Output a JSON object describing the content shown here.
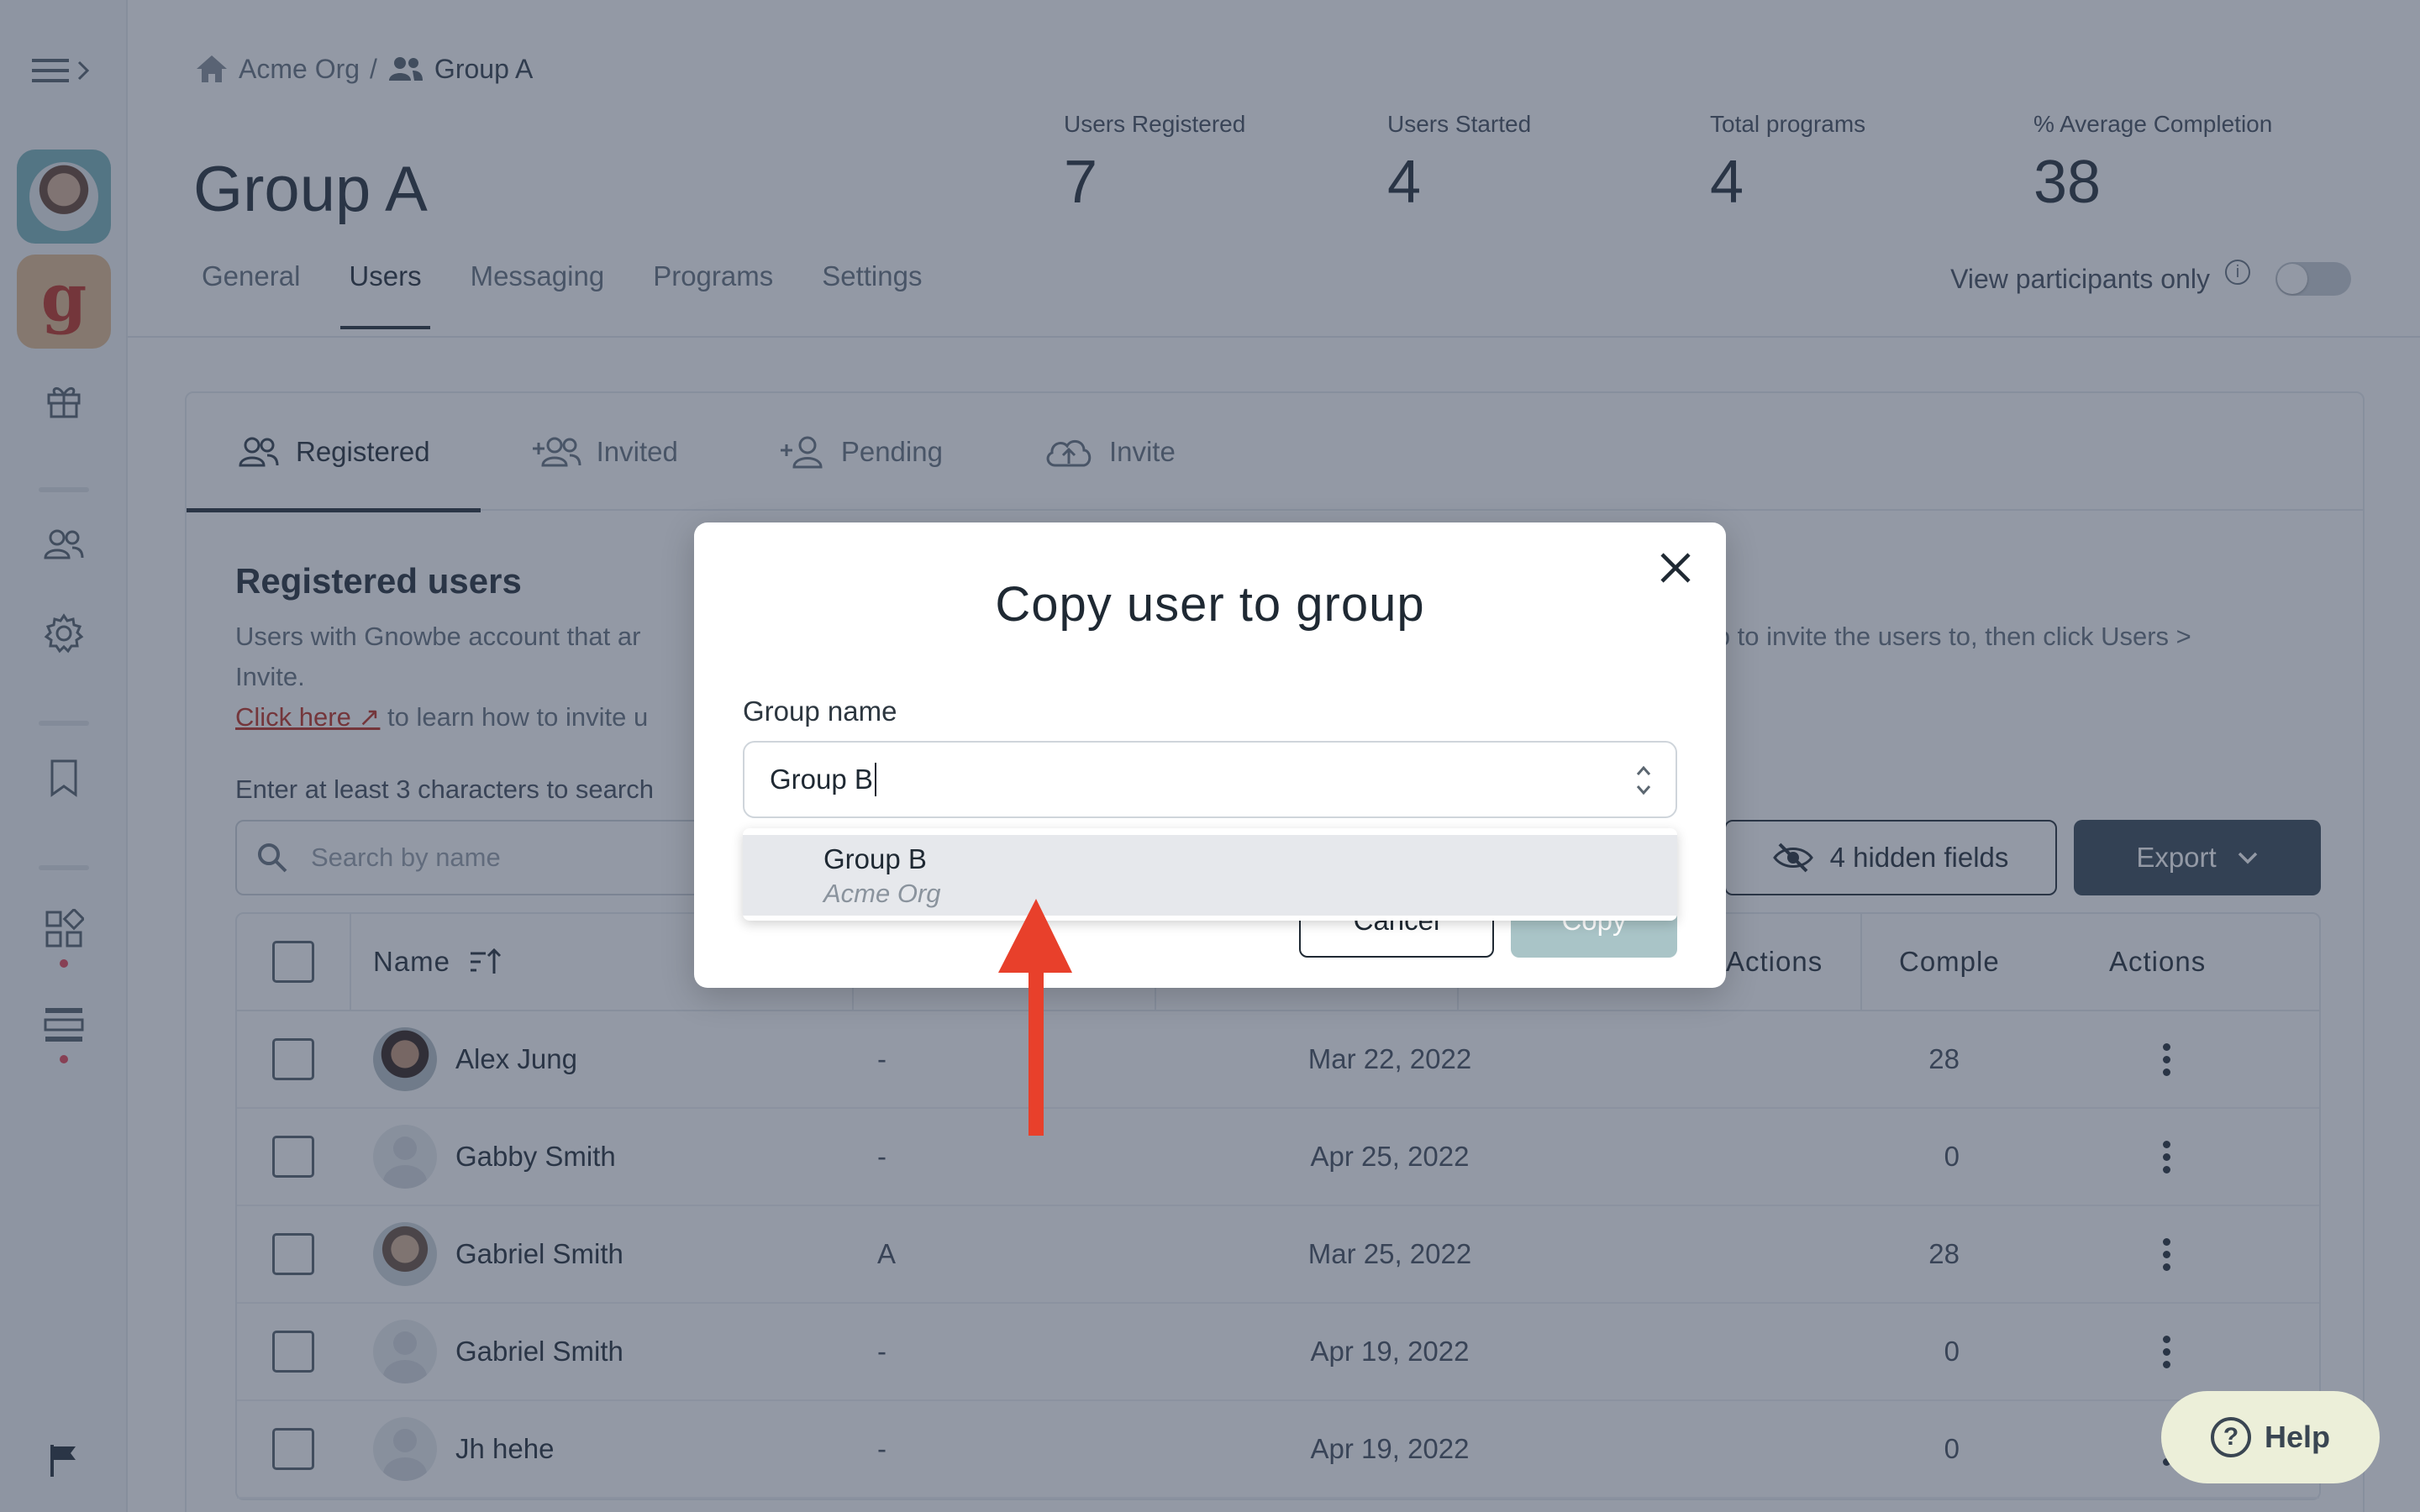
{
  "breadcrumb": {
    "org": "Acme Org",
    "separator": "/",
    "group": "Group A"
  },
  "page": {
    "title": "Group A"
  },
  "stats": [
    {
      "label": "Users Registered",
      "value": "7"
    },
    {
      "label": "Users Started",
      "value": "4"
    },
    {
      "label": "Total programs",
      "value": "4"
    },
    {
      "label": "% Average Completion",
      "value": "38"
    }
  ],
  "main_tabs": [
    "General",
    "Users",
    "Messaging",
    "Programs",
    "Settings"
  ],
  "participants": {
    "label": "View participants only",
    "enabled": false
  },
  "sub_tabs": [
    "Registered",
    "Invited",
    "Pending",
    "Invite"
  ],
  "section": {
    "title": "Registered users",
    "desc_start": "Users with Gnowbe account that ar",
    "desc_end": "group to invite the users to, then click Users >",
    "desc_line2": "Invite.",
    "link": "Click here ↗",
    "link_tail": "to learn how to invite u",
    "search_hint": "Enter at least 3 characters to search"
  },
  "search": {
    "placeholder": "Search by name"
  },
  "toolbar": {
    "hidden_fields": "4 hidden fields",
    "export": "Export"
  },
  "table": {
    "headers": {
      "name": "Name",
      "actions_count": "Actions",
      "completion": "Comple",
      "actions": "Actions"
    },
    "rows": [
      {
        "name": "Alex Jung",
        "b": "-",
        "date": "Mar 22, 2022",
        "actions": "28"
      },
      {
        "name": "Gabby Smith",
        "b": "-",
        "date": "Apr 25, 2022",
        "actions": "0"
      },
      {
        "name": "Gabriel Smith",
        "b": "A",
        "date": "Mar 25, 2022",
        "actions": "28"
      },
      {
        "name": "Gabriel Smith",
        "b": "-",
        "date": "Apr 19, 2022",
        "actions": "0"
      },
      {
        "name": "Jh hehe",
        "b": "-",
        "date": "Apr 19, 2022",
        "actions": "0"
      }
    ]
  },
  "modal": {
    "title": "Copy user to group",
    "field_label": "Group name",
    "input_value": "Group B",
    "option_main": "Group B",
    "option_sub": "Acme Org",
    "cancel": "Cancel",
    "copy": "Copy"
  },
  "help": {
    "label": "Help"
  },
  "colors": {
    "annotation_arrow": "#e8402b",
    "copy_button_disabled": "#a9c4c7",
    "export_button": "#3e4f5c"
  }
}
